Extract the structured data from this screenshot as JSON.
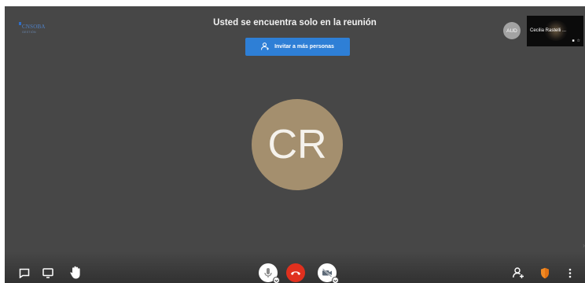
{
  "logo": {
    "name": "CNSOBA",
    "subtitle": "GESTIÓN"
  },
  "meeting": {
    "alone_message": "Usted se encuentra solo en la reunión"
  },
  "invite_button": {
    "label": "Invitar a más personas"
  },
  "small_avatar": {
    "initials": "AUD"
  },
  "thumbnail": {
    "participant_name": "Cecilia Rastelli ..."
  },
  "main_avatar": {
    "initials": "CR",
    "color": "#a48f6e"
  },
  "toolbar": {
    "left": [
      "chat-icon",
      "screen-share-icon",
      "raise-hand-icon"
    ],
    "center": [
      "microphone-icon",
      "hangup-icon",
      "camera-off-icon"
    ],
    "right": [
      "participants-icon",
      "security-shield-icon",
      "more-options-icon"
    ],
    "hangup_color": "#e0301e",
    "accent_color": "#2e7fd6"
  }
}
